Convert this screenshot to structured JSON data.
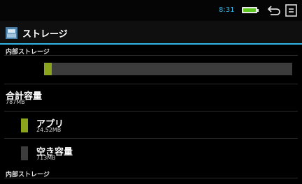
{
  "status_bar": {
    "time": "8:31",
    "battery_icon": "battery-charging-icon",
    "back_icon": "back-icon",
    "menu_icon": "menu-icon"
  },
  "action_bar": {
    "title": "ストレージ",
    "app_icon": "storage-icon"
  },
  "internal_storage": {
    "header": "内部ストレージ",
    "usage_fraction": 0.03,
    "total": {
      "label": "合計容量",
      "value": "787MB"
    },
    "items": [
      {
        "label": "アプリ",
        "value": "24.52MB",
        "color": "#8aa51c"
      },
      {
        "label": "空き容量",
        "value": "713MB",
        "color": "#3c3c3c"
      }
    ]
  },
  "section_footer": {
    "header": "内部ストレージ"
  },
  "colors": {
    "accent": "#33b5e5",
    "apps": "#8aa51c",
    "free": "#3c3c3c"
  }
}
